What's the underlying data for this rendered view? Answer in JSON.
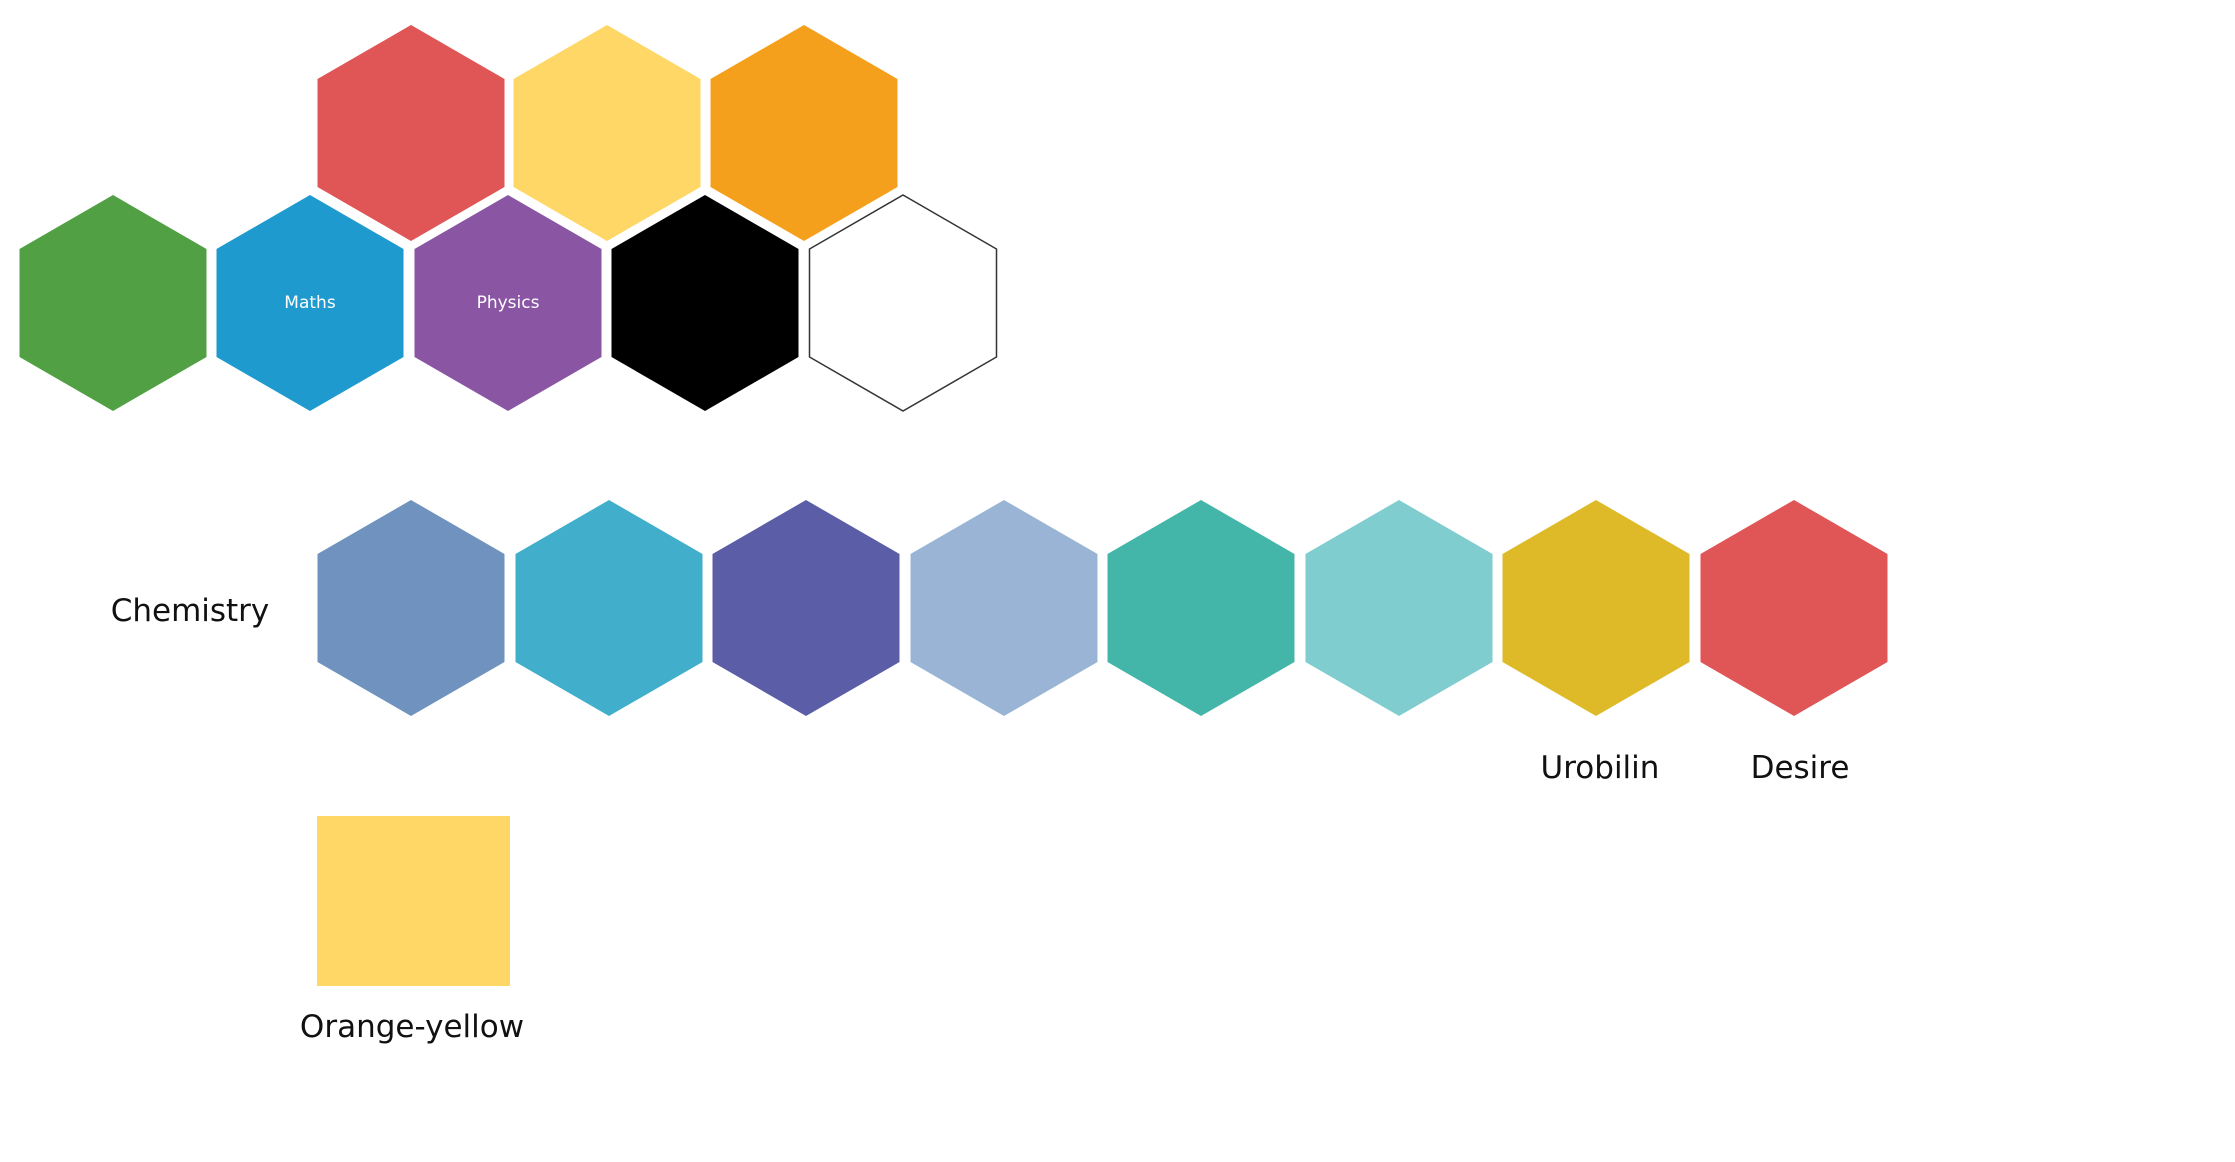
{
  "top_hexagons": [
    {
      "name": "hex-red",
      "color": "#E05555",
      "label": ""
    },
    {
      "name": "hex-yellow",
      "color": "#FFD766",
      "label": ""
    },
    {
      "name": "hex-orange",
      "color": "#F5A01D",
      "label": ""
    },
    {
      "name": "hex-green",
      "color": "#52A044",
      "label": ""
    },
    {
      "name": "hex-maths",
      "color": "#1E9ACE",
      "label": "Maths"
    },
    {
      "name": "hex-physics",
      "color": "#8A56A4",
      "label": "Physics"
    },
    {
      "name": "hex-black",
      "color": "#000000",
      "label": ""
    },
    {
      "name": "hex-white",
      "color": "#FFFFFF",
      "label": "",
      "outline": "#333333"
    }
  ],
  "chemistry": {
    "label": "Chemistry",
    "hexagons": [
      {
        "name": "hex-steel-blue",
        "color": "#6F93BE",
        "caption": ""
      },
      {
        "name": "hex-sky-cyan",
        "color": "#41AFCB",
        "caption": ""
      },
      {
        "name": "hex-indigo",
        "color": "#5C5DA7",
        "caption": ""
      },
      {
        "name": "hex-pale-blue",
        "color": "#99B4D5",
        "caption": ""
      },
      {
        "name": "hex-teal",
        "color": "#44B6A9",
        "caption": ""
      },
      {
        "name": "hex-light-teal",
        "color": "#7FCDCF",
        "caption": ""
      },
      {
        "name": "hex-urobilin",
        "color": "#DEBA29",
        "caption": "Urobilin"
      },
      {
        "name": "hex-desire",
        "color": "#E05555",
        "caption": "Desire"
      }
    ]
  },
  "swatch": {
    "color": "#FFD766",
    "caption": "Orange-yellow"
  }
}
